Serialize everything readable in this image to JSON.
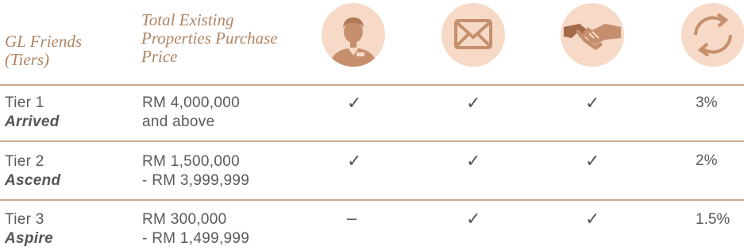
{
  "header": {
    "col_tier": "GL Friends (Tiers)",
    "col_price": "Total Existing Properties Purchase Price",
    "icons": [
      "agent-icon",
      "envelope-icon",
      "handshake-icon",
      "refresh-icon"
    ]
  },
  "rows": [
    {
      "tier": "Tier 1",
      "name": "Arrived",
      "price_line1": "RM 4,000,000",
      "price_line2": "and above",
      "c1": "✓",
      "c2": "✓",
      "c3": "✓",
      "rate": "3%"
    },
    {
      "tier": "Tier 2",
      "name": "Ascend",
      "price_line1": "RM 1,500,000",
      "price_line2": "- RM 3,999,999",
      "c1": "✓",
      "c2": "✓",
      "c3": "✓",
      "rate": "2%"
    },
    {
      "tier": "Tier 3",
      "name": "Aspire",
      "price_line1": "RM 300,000",
      "price_line2": "- RM 1,499,999",
      "c1": "–",
      "c2": "✓",
      "c3": "✓",
      "rate": "1.5%"
    }
  ],
  "colors": {
    "accent": "#b08463",
    "icon_bg": "#f6d9c6",
    "icon_fg": "#c58f6d",
    "rule": "#c9a88a"
  }
}
